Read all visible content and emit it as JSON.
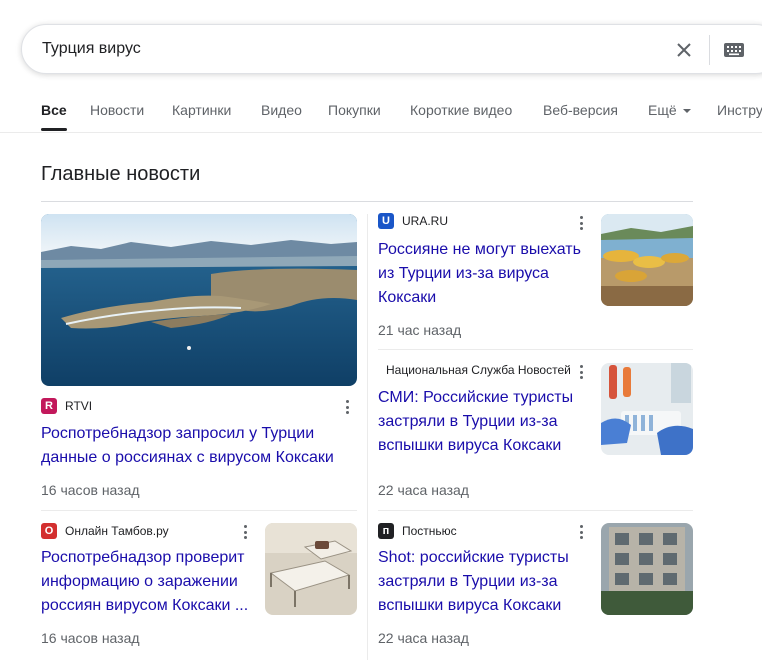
{
  "search": {
    "query": "Турция вирус"
  },
  "tabs": [
    "Все",
    "Новости",
    "Картинки",
    "Видео",
    "Покупки",
    "Короткие видео",
    "Веб-версия",
    "Ещё",
    "Инстру"
  ],
  "section_title": "Главные новости",
  "articles": [
    {
      "source": "RTVI",
      "favicon_letter": "R",
      "favicon_color": "#c2185b",
      "headline": "Роспотребнадзор запросил у Турции данные о россиянах с вирусом Коксаки",
      "time": "16 часов назад"
    },
    {
      "source": "URA.RU",
      "favicon_letter": "U",
      "favicon_color": "#1a56c8",
      "headline": "Россияне не могут выехать из Турции из-за вируса Коксаки",
      "time": "21 час назад"
    },
    {
      "source": "Национальная Служба Новостей",
      "favicon_letter": "",
      "headline": "СМИ: Российские туристы застряли в Турции из-за вспышки вируса Коксаки",
      "time": "22 часа назад"
    },
    {
      "source": "Онлайн Тамбов.ру",
      "favicon_letter": "О",
      "favicon_color": "#d32f2f",
      "headline": "Роспотребнадзор проверит информацию о заражении россиян вирусом Коксаки ...",
      "time": "16 часов назад"
    },
    {
      "source": "Постньюс",
      "favicon_letter": "п",
      "favicon_color": "#202124",
      "headline": "Shot: российские туристы застряли в Турции из-за вспышки вируса Коксаки",
      "time": "22 часа назад"
    }
  ]
}
